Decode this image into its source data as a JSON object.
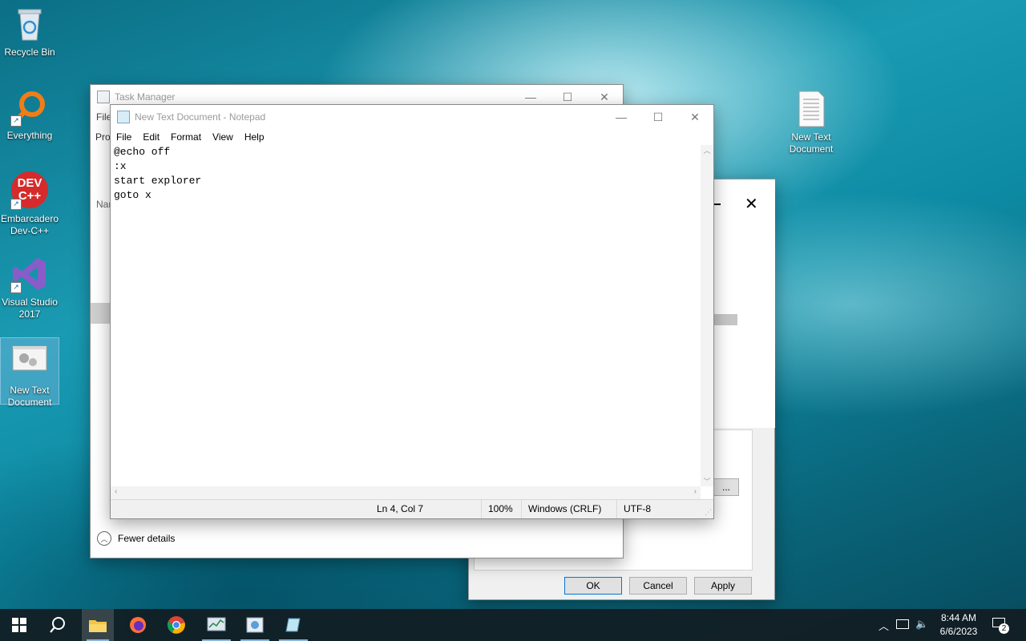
{
  "desktop": {
    "icons": [
      {
        "label_line1": "Recycle Bin",
        "label_line2": "",
        "icon": "recycle-bin-icon"
      },
      {
        "label_line1": "Everything",
        "label_line2": "",
        "icon": "everything-search-icon"
      },
      {
        "label_line1": "Embarcadero",
        "label_line2": "Dev-C++",
        "icon": "dev-cpp-icon",
        "badge": "DEV C++"
      },
      {
        "label_line1": "Visual Studio",
        "label_line2": "2017",
        "icon": "visual-studio-icon"
      },
      {
        "label_line1": "New Text",
        "label_line2": "Document",
        "icon": "batch-file-icon"
      },
      {
        "label_line1": "New Text",
        "label_line2": "Document",
        "icon": "text-file-icon"
      }
    ]
  },
  "task_manager": {
    "title": "Task Manager",
    "menu_file": "File",
    "tab_partial": "Pro",
    "column_partial": "Nar",
    "fewer_details": "Fewer details"
  },
  "properties_dialog": {
    "ok": "OK",
    "cancel": "Cancel",
    "apply": "Apply",
    "ellipsis": "..."
  },
  "notepad": {
    "title": "New Text Document - Notepad",
    "menu": [
      "File",
      "Edit",
      "Format",
      "View",
      "Help"
    ],
    "content": "@echo off\n:x\nstart explorer\ngoto x",
    "status": {
      "position": "Ln 4, Col 7",
      "zoom": "100%",
      "line_ending": "Windows (CRLF)",
      "encoding": "UTF-8"
    }
  },
  "taskbar": {
    "clock_time": "8:44 AM",
    "clock_date": "6/6/2023",
    "notification_count": "2",
    "accent": "#8ab4d8"
  }
}
